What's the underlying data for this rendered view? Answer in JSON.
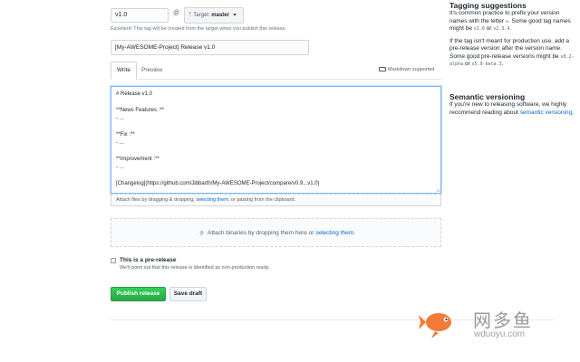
{
  "release_form": {
    "tag_value": "v1.0",
    "at_symbol": "@",
    "target_label": "Target:",
    "target_branch": "master",
    "tag_hint": "Excellent! This tag will be created from the target when you publish this release.",
    "title_value": "[My-AWESOME-Project] Release v1.0",
    "tabs": {
      "write": "Write",
      "preview": "Preview"
    },
    "markdown_supported": "Markdown supported",
    "editor_lines": [
      "# Release v1.0",
      "",
      "**News Features :**",
      "- ...",
      "",
      "**Fix :**",
      "- ...",
      "",
      "**Improvement :**",
      "- ...",
      "",
      "[Changelog](https://github.com/Jibbarth/My-AWESOME-Project/compare/v0.9...v1.0)"
    ],
    "attach_files": {
      "prefix": "Attach files by dragging & dropping, ",
      "link": "selecting them",
      "suffix": ", or pasting from the clipboard."
    },
    "attach_binaries": {
      "prefix": "Attach binaries by dropping them here or ",
      "link": "selecting them",
      "suffix": "."
    },
    "prerelease_label": "This is a pre-release",
    "prerelease_checked": false,
    "prerelease_note": "We'll point out that this release is identified as non-production ready.",
    "publish_button": "Publish release",
    "save_draft_button": "Save draft"
  },
  "sidebar": {
    "tagging_title": "Tagging suggestions",
    "tagging_p1_a": "It's common practice to prefix your version names with the letter ",
    "tagging_p1_code1": "v",
    "tagging_p1_b": ". Some good tag names might be ",
    "tagging_p1_code2": "v1.0",
    "tagging_p1_c": " or ",
    "tagging_p1_code3": "v2.3.4",
    "tagging_p1_d": ".",
    "tagging_p2_a": "If the tag isn't meant for production use, add a pre-release version after the version name. Some good pre-release versions might be ",
    "tagging_p2_code1": "v0.2-alpha",
    "tagging_p2_b": " or ",
    "tagging_p2_code2": "v5.9-beta.3",
    "tagging_p2_c": ".",
    "semver_title": "Semantic versioning",
    "semver_p": "If you're new to releasing software, we highly recommend reading about ",
    "semver_link": "semantic versioning",
    "semver_end": "."
  },
  "watermark": {
    "brand_cn": "网多鱼",
    "brand_url": "wduoyu.com"
  },
  "colors": {
    "accent_link": "#0366d6",
    "publish_green": "#28a745",
    "logo_orange": "#f47a3a"
  }
}
